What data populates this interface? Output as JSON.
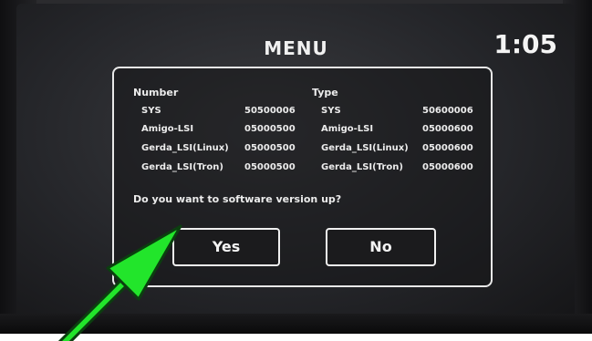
{
  "header": {
    "title": "MENU",
    "clock": "1:05"
  },
  "table": {
    "headers": {
      "number": "Number",
      "type": "Type"
    },
    "rows": [
      {
        "name": "SYS",
        "number": "50500006",
        "type_name": "SYS",
        "type_value": "50600006"
      },
      {
        "name": "Amigo-LSI",
        "number": "05000500",
        "type_name": "Amigo-LSI",
        "type_value": "05000600"
      },
      {
        "name": "Gerda_LSI(Linux)",
        "number": "05000500",
        "type_name": "Gerda_LSI(Linux)",
        "type_value": "05000600"
      },
      {
        "name": "Gerda_LSI(Tron)",
        "number": "05000500",
        "type_name": "Gerda_LSI(Tron)",
        "type_value": "05000600"
      }
    ]
  },
  "dialog": {
    "question": "Do you want to software version up?",
    "yes_label": "Yes",
    "no_label": "No"
  },
  "annotation": {
    "arrow_color": "#22e52b"
  }
}
